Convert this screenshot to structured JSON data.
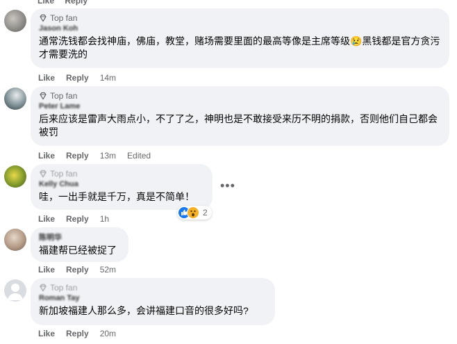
{
  "top_clip": {
    "like": "Like",
    "reply": "Reply"
  },
  "comments": [
    {
      "badge": "Top fan",
      "author": "Jason Koh",
      "text": "通常洗钱都会找神庙，佛庙，教堂，赌场需要里面的最高等像是主席等级😢黑钱都是官方贪污才需要洗的",
      "like": "Like",
      "reply": "Reply",
      "time": "14m",
      "edited": ""
    },
    {
      "badge": "Top fan",
      "author": "Peter Lame",
      "text": "后来应该是雷声大雨点小，不了了之，神明也是不敢接受来历不明的捐款，否则他们自己都会被罚",
      "like": "Like",
      "reply": "Reply",
      "time": "13m",
      "edited": "Edited"
    },
    {
      "badge": "Top fan",
      "author": "Kelly Chua",
      "text": "哇，一出手就是千万，真是不简单！",
      "like": "Like",
      "reply": "Reply",
      "time": "1h",
      "edited": "",
      "reaction_count": "2",
      "more": "•••"
    },
    {
      "badge": "",
      "author": "陈明华",
      "text": "福建帮已经被捉了",
      "like": "Like",
      "reply": "Reply",
      "time": "52m",
      "edited": ""
    },
    {
      "badge": "Top fan",
      "author": "Roman Tay",
      "text": "新加坡福建人那么多，会讲福建口音的很多好吗?",
      "like": "Like",
      "reply": "Reply",
      "time": "20m",
      "edited": ""
    }
  ],
  "colors": {
    "bubble": "#f0f2f5",
    "meta": "#65676b",
    "like_blue": "#1877f2",
    "wow_yellow": "#f7b125"
  }
}
